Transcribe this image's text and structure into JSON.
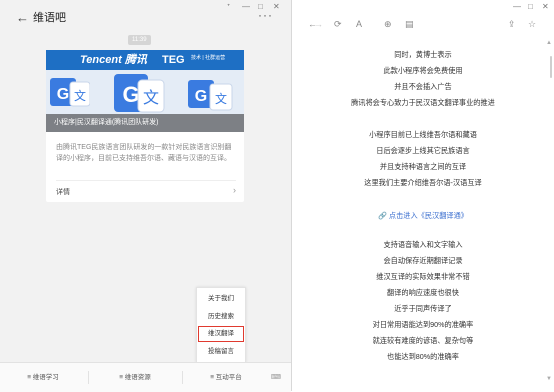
{
  "left": {
    "window_controls": [
      "ᐩ",
      "—",
      "□",
      "✕"
    ],
    "title": "维语吧",
    "time_badge": "11:39",
    "card": {
      "brand_logo": "Tencent 腾讯",
      "brand_teg": "TEG",
      "brand_sub": "技术 | 社群运营",
      "banner_caption": "小程序|民汉翻译通(腾讯团队研发)",
      "description": "由腾讯TEG民族语言团队研发的一款针对民族语言识别翻译的小程序，目前已支持维吾尔语、藏语与汉语的互译。",
      "detail_label": "详情"
    },
    "popup_menu": [
      "关于我们",
      "历史搜索",
      "维汉翻译",
      "投稿留言"
    ],
    "popup_selected_index": 2,
    "bottom_nav": [
      "≡ 维语学习",
      "≡ 维语资源",
      "≡ 互动平台"
    ]
  },
  "right": {
    "toolbar": [
      "←",
      "→",
      "⟳",
      "A",
      "⊕",
      "▤",
      "⇪",
      "☆"
    ],
    "lines": [
      "同时，黄博士表示",
      "此款小程序将会免费使用",
      "并且不会插入广告",
      "腾讯将会专心致力于民汉语文翻译事业的推进",
      "",
      "小程序目前已上线维吾尔语和藏语",
      "日后会逐步上线其它民族语言",
      "并且支持种语言之间的互译",
      "这里我们主要介绍维吾尔语-汉语互译",
      "",
      "🔗 点击进入《民汉翻译通》",
      "",
      "支持语音输入和文字输入",
      "会自动保存近期翻译记录",
      "维汉互译的实际效果非常不错",
      "翻译的响应速度也很快",
      "近乎于同声传译了",
      "对日常用语能达到90%的准确率",
      "就连较有难度的谚语、复杂句等",
      "也能达到80%的准确率"
    ],
    "link_index": 10
  },
  "colors": {
    "brand_blue": "#1e6fc4",
    "link_blue": "#3b6fcf",
    "highlight_red": "#e03a2f"
  }
}
